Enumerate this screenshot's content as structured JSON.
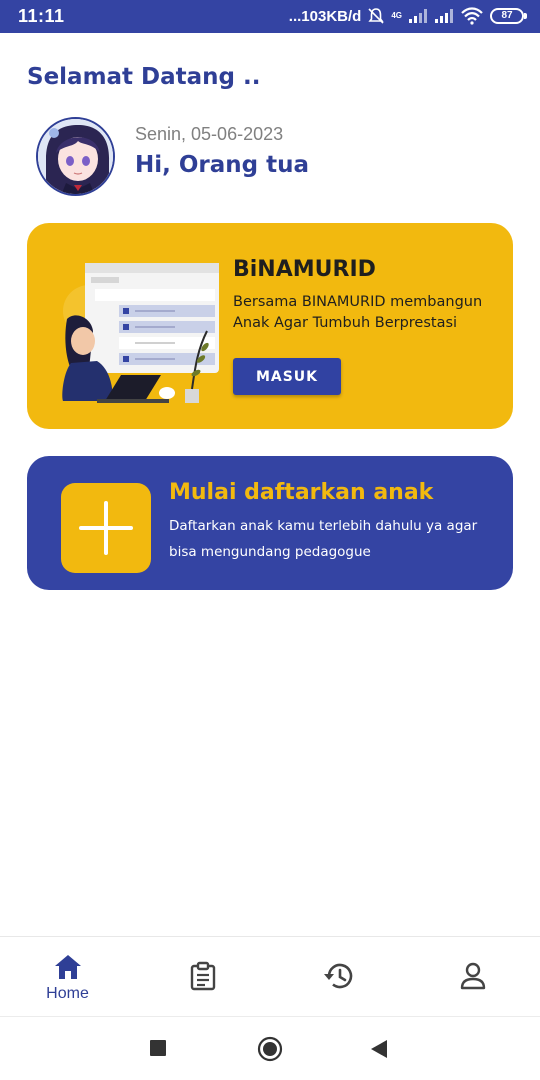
{
  "status_bar": {
    "time": "11:11",
    "speed": "...103KB/d",
    "network": "4G",
    "battery": "87",
    "bg_color": "#3444a3"
  },
  "greeting": {
    "welcome": "Selamat Datang ..",
    "date": "Senin, 05-06-2023",
    "hi": "Hi, Orang tua"
  },
  "brand_card": {
    "title": "BiNAMURID",
    "description": "Bersama BINAMURID membangun Anak Agar Tumbuh Berprestasi",
    "button_label": "MASUK",
    "bg_color": "#f2b90f"
  },
  "register_card": {
    "title": "Mulai daftarkan anak",
    "description": "Daftarkan anak kamu terlebih dahulu ya agar bisa mengundang pedagogue",
    "bg_color": "#3444a3",
    "icon": "plus-icon"
  },
  "bottom_nav": {
    "items": [
      {
        "label": "Home",
        "icon": "home-icon",
        "active": true
      },
      {
        "label": "",
        "icon": "clipboard-icon",
        "active": false
      },
      {
        "label": "",
        "icon": "history-icon",
        "active": false
      },
      {
        "label": "",
        "icon": "profile-icon",
        "active": false
      }
    ]
  },
  "system_nav": {
    "items": [
      "square-recents-icon",
      "circle-home-icon",
      "triangle-back-icon"
    ]
  }
}
